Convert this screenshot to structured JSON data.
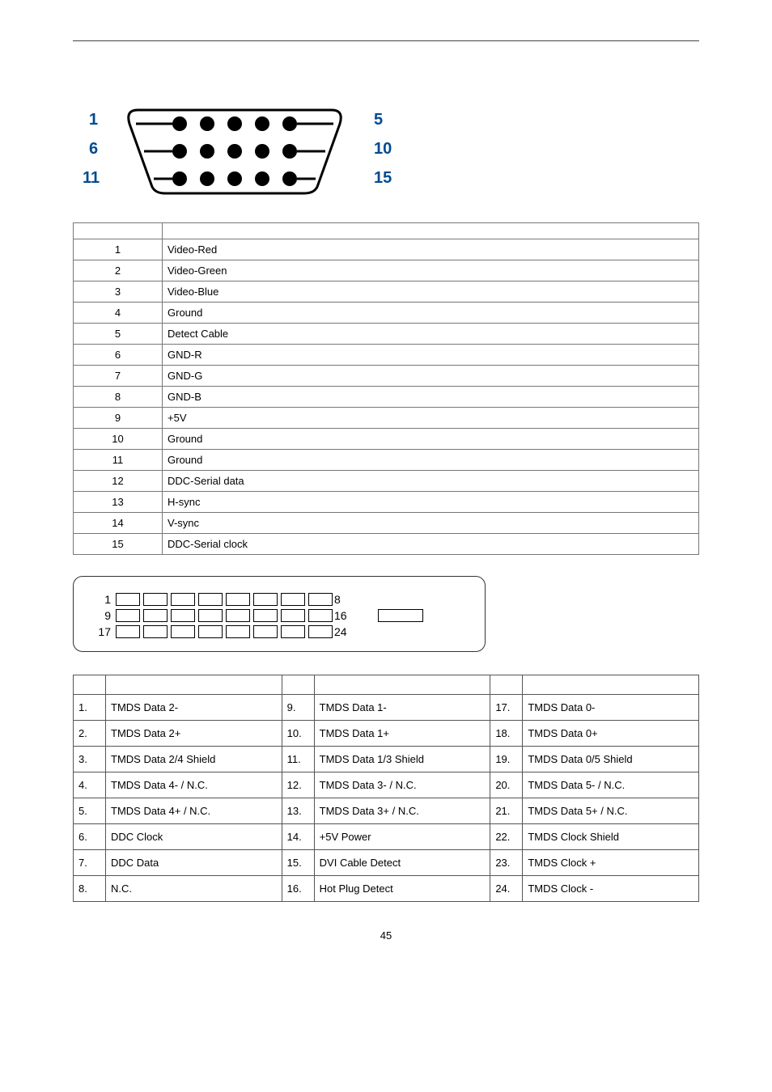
{
  "vga_diagram": {
    "labels": {
      "l1": "1",
      "l6": "6",
      "l11": "11",
      "l5": "5",
      "l10": "10",
      "l15": "15"
    }
  },
  "vga_table": {
    "rows": [
      {
        "pin": "1",
        "signal": "Video-Red"
      },
      {
        "pin": "2",
        "signal": "Video-Green"
      },
      {
        "pin": "3",
        "signal": "Video-Blue"
      },
      {
        "pin": "4",
        "signal": "Ground"
      },
      {
        "pin": "5",
        "signal": "Detect Cable"
      },
      {
        "pin": "6",
        "signal": "GND-R"
      },
      {
        "pin": "7",
        "signal": "GND-G"
      },
      {
        "pin": "8",
        "signal": "GND-B"
      },
      {
        "pin": "9",
        "signal": "+5V"
      },
      {
        "pin": "10",
        "signal": "Ground"
      },
      {
        "pin": "11",
        "signal": "Ground"
      },
      {
        "pin": "12",
        "signal": "DDC-Serial data"
      },
      {
        "pin": "13",
        "signal": "H-sync"
      },
      {
        "pin": "14",
        "signal": "V-sync"
      },
      {
        "pin": "15",
        "signal": "DDC-Serial clock"
      }
    ]
  },
  "dvi_diagram": {
    "rows": [
      {
        "left": "1",
        "right": "8"
      },
      {
        "left": "9",
        "right": "16"
      },
      {
        "left": "17",
        "right": "24"
      }
    ]
  },
  "dvi_table": {
    "rows": [
      {
        "p1": "1.",
        "s1": "TMDS Data 2-",
        "p2": "9.",
        "s2": "TMDS Data 1-",
        "p3": "17.",
        "s3": "TMDS Data 0-"
      },
      {
        "p1": "2.",
        "s1": "TMDS Data 2+",
        "p2": "10.",
        "s2": "TMDS Data 1+",
        "p3": "18.",
        "s3": "TMDS Data 0+"
      },
      {
        "p1": "3.",
        "s1": "TMDS Data 2/4 Shield",
        "p2": "11.",
        "s2": "TMDS Data 1/3 Shield",
        "p3": "19.",
        "s3": "TMDS Data 0/5 Shield"
      },
      {
        "p1": "4.",
        "s1": "TMDS Data 4- / N.C.",
        "p2": "12.",
        "s2": "TMDS Data 3- / N.C.",
        "p3": "20.",
        "s3": "TMDS Data 5- / N.C."
      },
      {
        "p1": "5.",
        "s1": "TMDS Data 4+ / N.C.",
        "p2": "13.",
        "s2": "TMDS Data 3+ / N.C.",
        "p3": "21.",
        "s3": "TMDS Data 5+ / N.C."
      },
      {
        "p1": "6.",
        "s1": "DDC Clock",
        "p2": "14.",
        "s2": "+5V Power",
        "p3": "22.",
        "s3": "TMDS Clock Shield"
      },
      {
        "p1": "7.",
        "s1": "DDC Data",
        "p2": "15.",
        "s2": "DVI Cable Detect",
        "p3": "23.",
        "s3": "TMDS Clock +"
      },
      {
        "p1": "8.",
        "s1": "N.C.",
        "p2": "16.",
        "s2": "Hot Plug Detect",
        "p3": "24.",
        "s3": "TMDS Clock -"
      }
    ]
  },
  "page_number": "45"
}
